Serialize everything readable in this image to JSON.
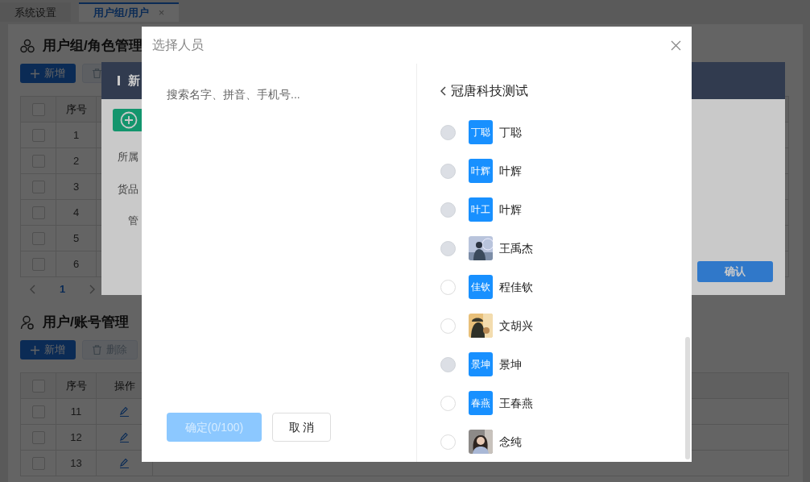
{
  "tabs": [
    {
      "label": "系统设置",
      "selected": false
    },
    {
      "label": "用户组/用户",
      "selected": true,
      "close": "×"
    }
  ],
  "role_section": {
    "title": "用户组/角色管理",
    "buttons": [
      {
        "kind": "add",
        "label": "新增"
      },
      {
        "kind": "delete"
      }
    ],
    "table": {
      "all_checked": false,
      "columns": [
        "序号"
      ],
      "rows": [
        {
          "index": "1",
          "checked": false
        },
        {
          "index": "2",
          "checked": false
        },
        {
          "index": "3",
          "checked": false
        },
        {
          "index": "4",
          "checked": false
        },
        {
          "index": "5",
          "checked": false
        },
        {
          "index": "6",
          "checked": false
        }
      ]
    },
    "pagination": {
      "current": "1"
    }
  },
  "account_section": {
    "title": "用户/账号管理",
    "buttons": [
      {
        "kind": "add",
        "label": "新增"
      },
      {
        "kind": "delete",
        "label": "删除"
      }
    ],
    "table": {
      "all_checked": false,
      "columns": [
        "序号",
        "操作"
      ],
      "rows": [
        {
          "index": "11",
          "checked": false
        },
        {
          "index": "12",
          "checked": false
        },
        {
          "index": "13",
          "checked": false
        }
      ]
    }
  },
  "role_dialog": {
    "title": "新",
    "fields": [
      "所属",
      "货品",
      "管"
    ],
    "confirm": "确认"
  },
  "picker": {
    "title": "选择人员",
    "search": {
      "placeholder": "搜索名字、拼音、手机号..."
    },
    "confirm": {
      "label": "确定(0/100)",
      "disabled": true
    },
    "cancel": "取 消",
    "group": "冠唐科技测试",
    "people": [
      {
        "name": "丁聪",
        "kind": "initials",
        "avatar_text": "丁聪",
        "disabled": true
      },
      {
        "name": "叶辉",
        "kind": "initials",
        "avatar_text": "叶辉",
        "disabled": true
      },
      {
        "name": "叶辉",
        "kind": "initials",
        "avatar_text": "叶工",
        "disabled": true
      },
      {
        "name": "王禹杰",
        "disabled": true
      },
      {
        "name": "程佳钦",
        "kind": "initials",
        "avatar_text": "佳钦",
        "disabled": false
      },
      {
        "name": "文胡兴",
        "disabled": false
      },
      {
        "name": "景坤",
        "kind": "initials",
        "avatar_text": "景坤",
        "disabled": true
      },
      {
        "name": "王春燕",
        "kind": "initials",
        "avatar_text": "春燕",
        "disabled": false
      },
      {
        "name": "念纯",
        "disabled": false
      }
    ]
  }
}
